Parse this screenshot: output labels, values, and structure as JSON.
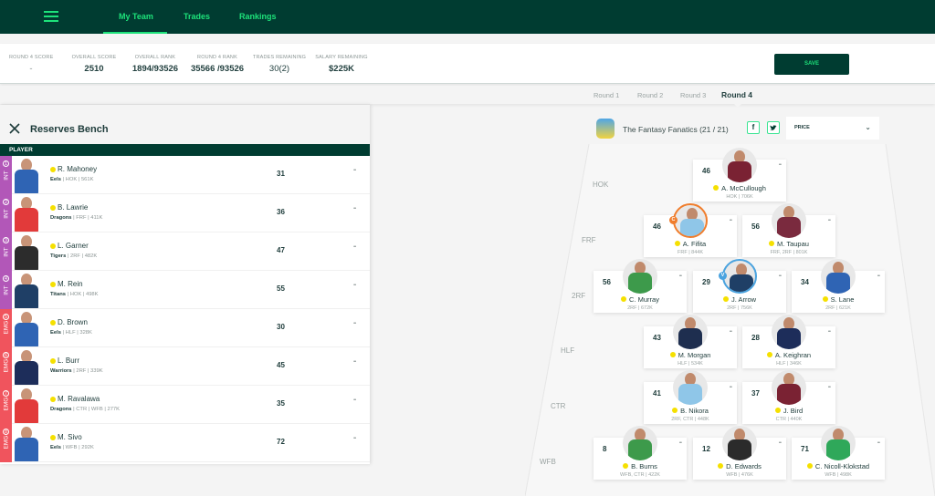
{
  "nav": {
    "menu_icon": "hamburger-icon",
    "items": [
      {
        "label": "My Team",
        "active": true
      },
      {
        "label": "Trades",
        "active": false
      },
      {
        "label": "Rankings",
        "active": false
      }
    ],
    "accent": "#1de27a",
    "bg": "#003c31"
  },
  "stats": [
    {
      "label": "ROUND 4 SCORE",
      "value": "-"
    },
    {
      "label": "OVERALL SCORE",
      "value": "2510"
    },
    {
      "label": "OVERALL RANK",
      "value": "1894/93526"
    },
    {
      "label": "ROUND 4 RANK",
      "value": "35566 /93526"
    },
    {
      "label": "TRADES REMAINING",
      "value": "30(2)"
    },
    {
      "label": "SALARY REMAINING",
      "value": "$225K"
    }
  ],
  "save_label": "SAVE",
  "rounds": [
    {
      "label": "Round 1",
      "active": false
    },
    {
      "label": "Round 2",
      "active": false
    },
    {
      "label": "Round 3",
      "active": false
    },
    {
      "label": "Round 4",
      "active": true
    }
  ],
  "reserves": {
    "title": "Reserves Bench",
    "close_icon": "close-icon",
    "column_header": "PLAYER",
    "players": [
      {
        "slot": "INT",
        "slot_num": "1",
        "name": "R. Mahoney",
        "team": "Eels",
        "details": "HOK | 561K",
        "score": "31",
        "jersey": "#2f64b4"
      },
      {
        "slot": "INT",
        "slot_num": "2",
        "name": "B. Lawrie",
        "team": "Dragons",
        "details": "FRF | 411K",
        "score": "36",
        "jersey": "#e23a3a"
      },
      {
        "slot": "INT",
        "slot_num": "3",
        "name": "L. Garner",
        "team": "Tigers",
        "details": "2RF | 482K",
        "score": "47",
        "jersey": "#2c2c2c"
      },
      {
        "slot": "INT",
        "slot_num": "4",
        "name": "M. Rein",
        "team": "Titans",
        "details": "HOK | 498K",
        "score": "55",
        "jersey": "#1f3f66"
      },
      {
        "slot": "EMG",
        "slot_num": "5",
        "name": "D. Brown",
        "team": "Eels",
        "details": "HLF | 328K",
        "score": "30",
        "jersey": "#2f64b4"
      },
      {
        "slot": "EMG",
        "slot_num": "6",
        "name": "L. Burr",
        "team": "Warriors",
        "details": "2RF | 339K",
        "score": "45",
        "jersey": "#1d2d5a"
      },
      {
        "slot": "EMG",
        "slot_num": "7",
        "name": "M. Ravalawa",
        "team": "Dragons",
        "details": "CTR | WFB | 277K",
        "score": "35",
        "jersey": "#e23a3a"
      },
      {
        "slot": "EMG",
        "slot_num": "8",
        "name": "M. Sivo",
        "team": "Eels",
        "details": "WFB | 292K",
        "score": "72",
        "jersey": "#2f64b4"
      }
    ]
  },
  "field": {
    "team_name": "The Fantasy Fanatics (21 / 21)",
    "facebook_label": "f",
    "twitter_label": "t",
    "sort_label": "PRICE",
    "position_labels": [
      "HOK",
      "FRF",
      "2RF",
      "HLF",
      "CTR",
      "WFB"
    ],
    "players": [
      {
        "name": "A. McCullough",
        "info": "HOK | 706K",
        "score": "46",
        "jersey": "#7a2233",
        "role": ""
      },
      {
        "name": "A. Fifita",
        "info": "FRF | 844K",
        "score": "46",
        "jersey": "#8fc6e8",
        "role": "C"
      },
      {
        "name": "M. Taupau",
        "info": "FRF, 2RF | 801K",
        "score": "56",
        "jersey": "#7a2a3e",
        "role": ""
      },
      {
        "name": "C. Murray",
        "info": "2RF | 672K",
        "score": "56",
        "jersey": "#3d9a4b",
        "role": ""
      },
      {
        "name": "J. Arrow",
        "info": "2RF | 756K",
        "score": "29",
        "jersey": "#1f3f66",
        "role": "V"
      },
      {
        "name": "S. Lane",
        "info": "2RF | 621K",
        "score": "34",
        "jersey": "#2f64b4",
        "role": ""
      },
      {
        "name": "M. Morgan",
        "info": "HLF | 534K",
        "score": "43",
        "jersey": "#1e2e4f",
        "role": ""
      },
      {
        "name": "A. Keighran",
        "info": "HLF | 346K",
        "score": "28",
        "jersey": "#1d2d5a",
        "role": ""
      },
      {
        "name": "B. Nikora",
        "info": "2RF, CTR | 448K",
        "score": "41",
        "jersey": "#8fc6e8",
        "role": ""
      },
      {
        "name": "J. Bird",
        "info": "CTR | 440K",
        "score": "37",
        "jersey": "#7a2233",
        "role": ""
      },
      {
        "name": "B. Burns",
        "info": "WFB, CTR | 422K",
        "score": "8",
        "jersey": "#3d9a4b",
        "role": ""
      },
      {
        "name": "D. Edwards",
        "info": "WFB | 476K",
        "score": "12",
        "jersey": "#2b2b2b",
        "role": ""
      },
      {
        "name": "C. Nicoll-Klokstad",
        "info": "WFB | 498K",
        "score": "71",
        "jersey": "#2fa85a",
        "role": ""
      }
    ]
  },
  "colors": {
    "int_slot": "#b257b8",
    "emg_slot": "#f0545d",
    "captain": "#f07d2c",
    "vice_captain": "#4aa3df",
    "status_dot": "#f5e000"
  }
}
